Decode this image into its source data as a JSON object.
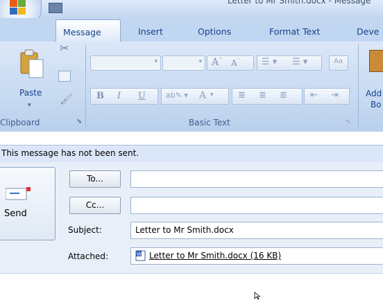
{
  "window": {
    "title": "Letter to Mr Smith.docx - Message"
  },
  "tabs": [
    {
      "label": "Message",
      "selected": true
    },
    {
      "label": "Insert"
    },
    {
      "label": "Options"
    },
    {
      "label": "Format Text"
    },
    {
      "label": "Deve"
    }
  ],
  "ribbon": {
    "clipboard": {
      "label": "Clipboard",
      "paste_label": "Paste"
    },
    "basic_text": {
      "label": "Basic Text",
      "bold": "B",
      "italic": "I",
      "underline": "U",
      "font_color_glyph": "A"
    },
    "partial_group": {
      "line1": "Add",
      "line2": "Bo"
    }
  },
  "infobar": {
    "text": "This message has not been sent."
  },
  "send": {
    "label": "Send"
  },
  "form": {
    "to_label": "To...",
    "to_value": "",
    "cc_label": "Cc...",
    "cc_value": "",
    "subject_label": "Subject:",
    "subject_value": "Letter to Mr Smith.docx",
    "attached_label": "Attached:",
    "attachment_name": "Letter to Mr Smith.docx (16 KB)"
  },
  "colors": {
    "accent": "#15428b",
    "ribbon": "#c8dbf2",
    "infobar": "#dbe7f8"
  }
}
